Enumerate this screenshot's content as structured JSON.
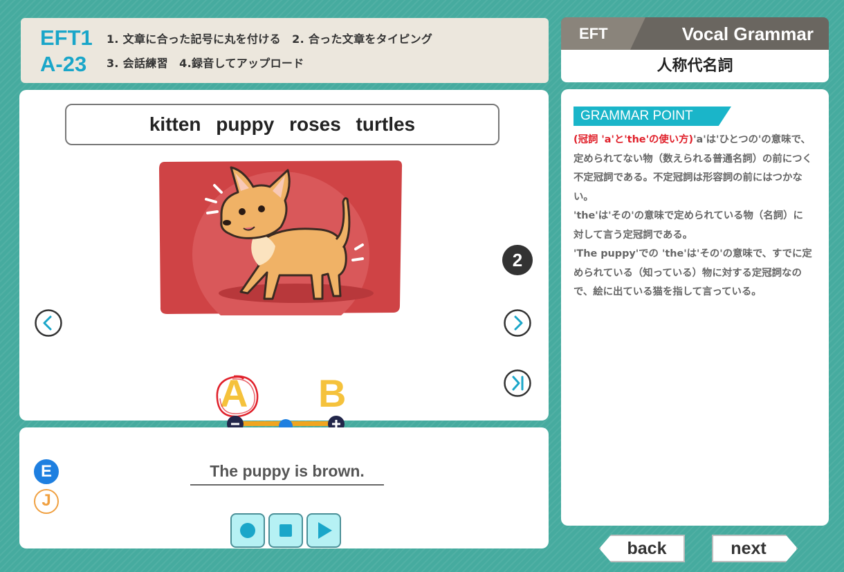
{
  "header": {
    "lesson_code": "EFT1",
    "lesson_id": "A-23",
    "instruction_line1": "1. 文章に合った記号に丸を付ける　2. 合った文章をタイピング",
    "instruction_line2": "3. 会話練習　4.録音してアップロード"
  },
  "main": {
    "words": "kitten   puppy   roses   turtles",
    "page_number": "2",
    "option_a": "A",
    "option_b": "B",
    "selected_option": "A"
  },
  "sentence": {
    "text": "The puppy is brown.",
    "lang_english": "E",
    "lang_japanese": "J"
  },
  "right": {
    "badge": "EFT",
    "title": "Vocal Grammar",
    "topic": "人称代名詞",
    "grammar_label": "GRAMMAR POINT",
    "grammar_heading": "(冠詞 'a'と'the'の使い方)",
    "grammar_p1": "'a'は'ひとつの'の意味で、定められてない物（数えられる普通名詞）の前につく不定冠詞である。不定冠詞は形容詞の前にはつかない。",
    "grammar_p2": "'the'は'その'の意味で定められている物（名詞）に対して言う定冠詞である。",
    "grammar_p3": "'The puppy'での 'the'は'その'の意味で、すでに定められている（知っている）物に対する定冠詞なので、絵に出ている猫を指して言っている。"
  },
  "nav": {
    "back_label": "back",
    "next_label": "next"
  },
  "colors": {
    "background": "#46ab9f",
    "accent": "#1aa6c9",
    "option_yellow": "#f5c23c",
    "mark_red": "#e0202a",
    "picture_bg": "#cf4345"
  },
  "icons": [
    "chevron-left-icon",
    "chevron-right-icon",
    "skip-to-end-icon",
    "minus-icon",
    "plus-icon",
    "record-icon",
    "stop-icon",
    "play-icon",
    "puppy-illustration"
  ]
}
